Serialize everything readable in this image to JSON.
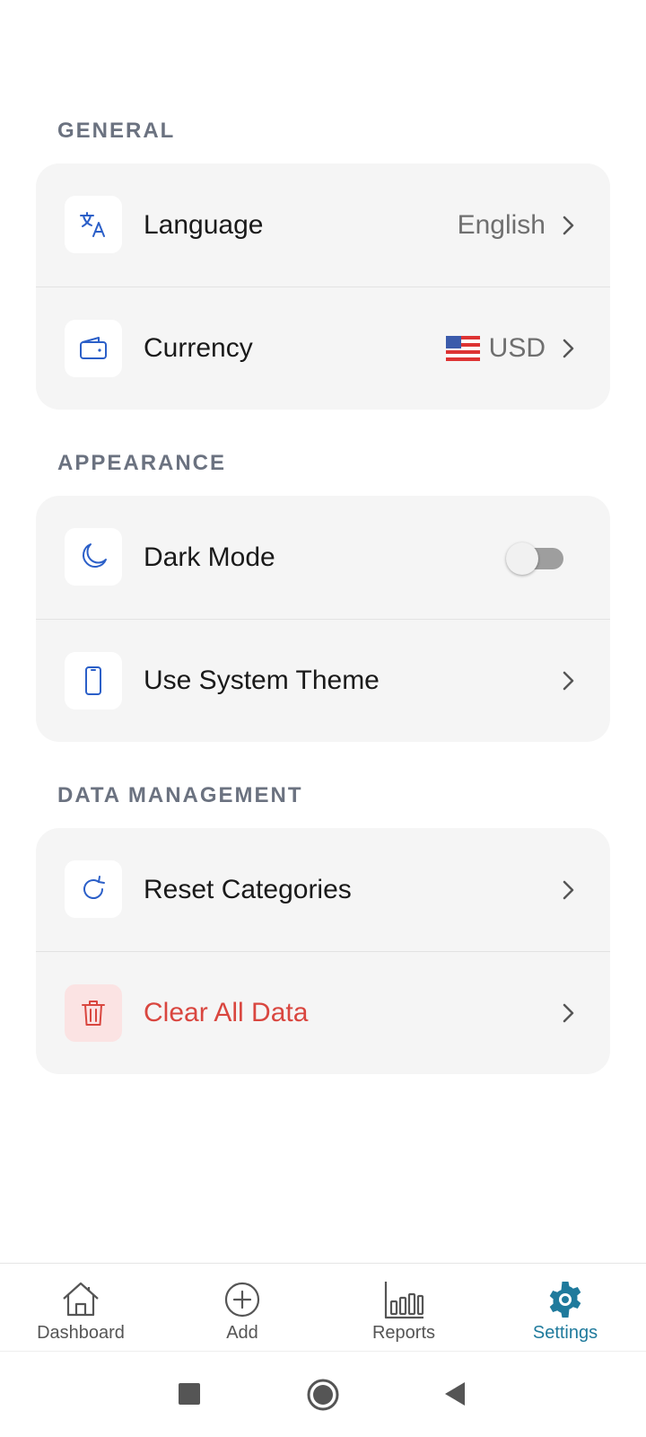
{
  "sections": [
    {
      "title": "GENERAL",
      "rows": [
        {
          "icon": "translate-icon",
          "label": "Language",
          "value": "English"
        },
        {
          "icon": "wallet-icon",
          "label": "Currency",
          "value": "USD",
          "flag": "us-flag-icon"
        }
      ]
    },
    {
      "title": "APPEARANCE",
      "rows": [
        {
          "icon": "moon-icon",
          "label": "Dark Mode",
          "toggle_on": false
        },
        {
          "icon": "smartphone-icon",
          "label": "Use System Theme"
        }
      ]
    },
    {
      "title": "DATA MANAGEMENT",
      "rows": [
        {
          "icon": "refresh-icon",
          "label": "Reset Categories"
        },
        {
          "icon": "trash-icon",
          "label": "Clear All Data"
        }
      ]
    }
  ],
  "bottom_nav": [
    {
      "icon": "home-icon",
      "label": "Dashboard"
    },
    {
      "icon": "plus-circle-icon",
      "label": "Add"
    },
    {
      "icon": "bar-chart-icon",
      "label": "Reports"
    },
    {
      "icon": "gear-icon",
      "label": "Settings",
      "active": true
    }
  ],
  "system_nav": [
    "recents-square-icon",
    "home-circle-icon",
    "back-triangle-icon"
  ],
  "colors": {
    "accent_blue": "#2b5fc8",
    "danger_red": "#d9463f",
    "active_teal": "#1f7a9c",
    "section_gray": "#6b7280"
  }
}
